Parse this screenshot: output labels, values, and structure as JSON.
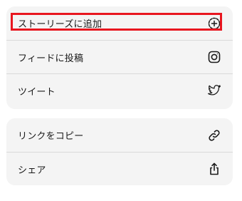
{
  "share_sheet": {
    "group_primary": [
      {
        "label": "ストーリーズに追加",
        "icon": "add-circle-icon"
      },
      {
        "label": "フィードに投稿",
        "icon": "instagram-icon"
      },
      {
        "label": "ツイート",
        "icon": "twitter-bird-icon"
      }
    ],
    "group_secondary": [
      {
        "label": "リンクをコピー",
        "icon": "link-icon"
      },
      {
        "label": "シェア",
        "icon": "share-upload-icon"
      }
    ]
  },
  "highlight": {
    "target": "ストーリーズに追加",
    "color": "#e8161f"
  },
  "colors": {
    "group_background": "#f4f4f4",
    "divider": "#d9d9d9",
    "text": "#1a1a1a"
  }
}
